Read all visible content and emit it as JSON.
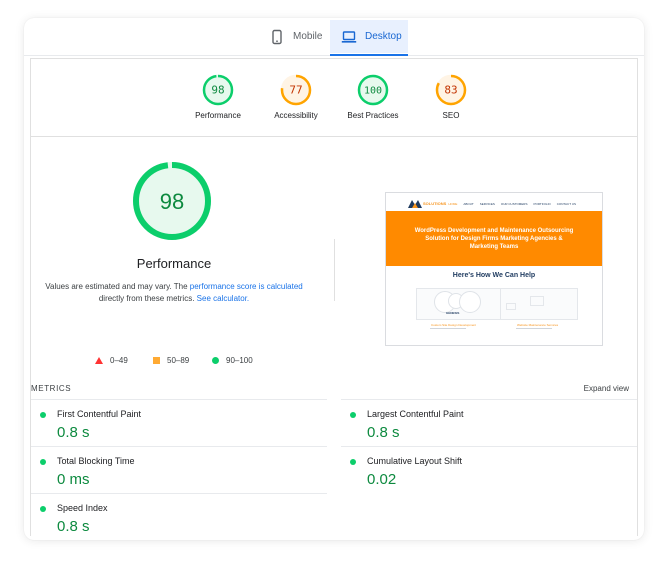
{
  "tabs": [
    {
      "label": "Mobile",
      "icon": "phone-icon",
      "active": false
    },
    {
      "label": "Desktop",
      "icon": "laptop-icon",
      "active": true
    }
  ],
  "colors": {
    "pass": "#0cce6b",
    "pass_text": "#0d8a3f",
    "average": "#ffa400",
    "average_text": "#c33300",
    "fail": "#ff3333",
    "accent": "#1a73e8"
  },
  "gauges": [
    {
      "score": "98",
      "label": "Performance",
      "status": "pass",
      "value": 98
    },
    {
      "score": "77",
      "label": "Accessibility",
      "status": "average",
      "value": 77
    },
    {
      "score": "100",
      "label": "Best Practices",
      "status": "pass",
      "value": 100
    },
    {
      "score": "83",
      "label": "SEO",
      "status": "average",
      "value": 83
    }
  ],
  "performance": {
    "score": "98",
    "value": 98,
    "title": "Performance",
    "desc_prefix": "Values are estimated and may vary. The ",
    "desc_link1": "performance score is calculated",
    "desc_mid": " directly from these metrics. ",
    "desc_link2": "See calculator."
  },
  "legend": [
    {
      "range": "0–49",
      "shape": "triangle"
    },
    {
      "range": "50–89",
      "shape": "square"
    },
    {
      "range": "90–100",
      "shape": "circle"
    }
  ],
  "thumbnail": {
    "logo_text": "SOLUTIONS",
    "menu": [
      "HOME",
      "ABOUT",
      "SERVICES",
      "OUR CUSTOMERS",
      "PORTFOLIO",
      "CONTACT US"
    ],
    "hero_text": "WordPress Development and Maintenance Outsourcing Solution for Design Firms Marketing Agencies & Marketing Teams",
    "subheading": "Here's How We Can Help",
    "card_left_title": "GENESIS",
    "card_left_caption": "Custom Site Design Development",
    "card_right_caption": "Website Maintenance Services"
  },
  "metrics": {
    "heading": "METRICS",
    "expand_label": "Expand view",
    "items": [
      {
        "name": "First Contentful Paint",
        "value": "0.8 s"
      },
      {
        "name": "Largest Contentful Paint",
        "value": "0.8 s"
      },
      {
        "name": "Total Blocking Time",
        "value": "0 ms"
      },
      {
        "name": "Cumulative Layout Shift",
        "value": "0.02"
      },
      {
        "name": "Speed Index",
        "value": "0.8 s"
      }
    ]
  }
}
